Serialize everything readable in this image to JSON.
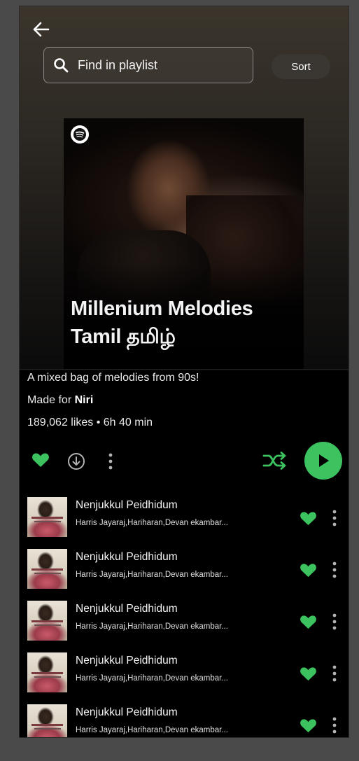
{
  "header": {
    "search_placeholder": "Find in playlist",
    "sort_label": "Sort"
  },
  "cover": {
    "title_line1": "Millenium Melodies",
    "title_line2": "Tamil தமிழ்"
  },
  "playlist": {
    "description": "A mixed bag of melodies from 90s!",
    "made_for_prefix": "Made for ",
    "made_for_user": "Niri",
    "stats": "189,062 likes • 6h 40 min"
  },
  "colors": {
    "accent_green": "#3cc25e",
    "background": "#000000"
  },
  "icons": {
    "back": "back-arrow-icon",
    "search": "search-icon",
    "spotify": "spotify-logo-icon",
    "heart": "heart-filled-icon",
    "download": "download-icon",
    "more": "more-vertical-icon",
    "shuffle": "shuffle-icon",
    "play": "play-icon"
  },
  "tracks": [
    {
      "title": "Nenjukkul Peidhidum",
      "artist": "Harris Jayaraj,Hariharan,Devan ekambar...",
      "liked": true
    },
    {
      "title": "Nenjukkul Peidhidum",
      "artist": "Harris Jayaraj,Hariharan,Devan ekambar...",
      "liked": true
    },
    {
      "title": "Nenjukkul Peidhidum",
      "artist": "Harris Jayaraj,Hariharan,Devan ekambar...",
      "liked": true
    },
    {
      "title": "Nenjukkul Peidhidum",
      "artist": "Harris Jayaraj,Hariharan,Devan ekambar...",
      "liked": true
    },
    {
      "title": "Nenjukkul Peidhidum",
      "artist": "Harris Jayaraj,Hariharan,Devan ekambar...",
      "liked": true
    }
  ]
}
